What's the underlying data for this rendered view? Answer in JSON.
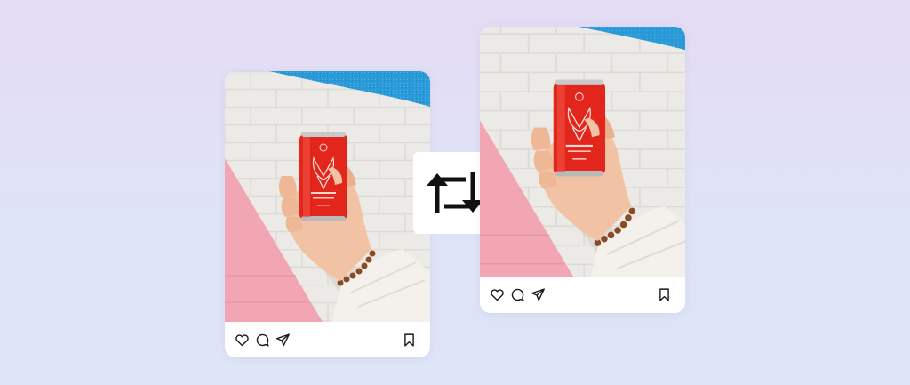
{
  "colors": {
    "background_top": "#e4dbf5",
    "background_bottom": "#dde5f7",
    "card": "#ffffff",
    "icon": "#1a1a1a",
    "wall": "#ecebe7",
    "wall_blue": "#2b9fde",
    "wall_pink": "#f0a4b1",
    "can_red": "#e2261d"
  },
  "posts": [
    {
      "id": "original",
      "image": "photo-hand-holding-red-can",
      "actions": [
        "heart-icon",
        "comment-icon",
        "share-icon"
      ],
      "save": "bookmark-icon"
    },
    {
      "id": "reposted",
      "image": "photo-hand-holding-red-can-cropped",
      "actions": [
        "heart-icon",
        "comment-icon",
        "share-icon"
      ],
      "save": "bookmark-icon"
    }
  ],
  "center": {
    "icon": "repost-icon"
  }
}
